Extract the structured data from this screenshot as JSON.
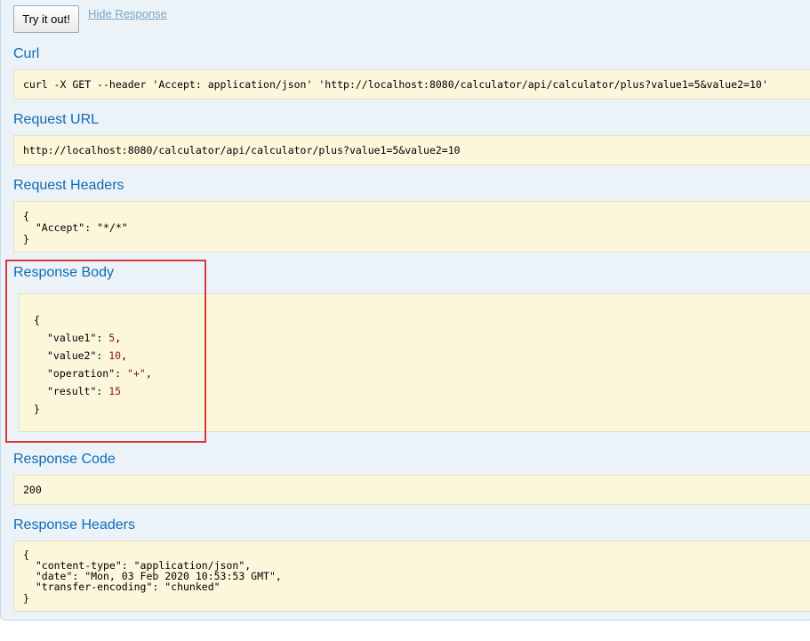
{
  "actions": {
    "try_button": "Try it out!",
    "hide_link": "Hide Response"
  },
  "curl": {
    "title": "Curl",
    "value": "curl -X GET --header 'Accept: application/json' 'http://localhost:8080/calculator/api/calculator/plus?value1=5&value2=10'"
  },
  "request_url": {
    "title": "Request URL",
    "value": "http://localhost:8080/calculator/api/calculator/plus?value1=5&value2=10"
  },
  "request_headers": {
    "title": "Request Headers",
    "lines": [
      "{",
      "  \"Accept\": \"*/*\"",
      "}"
    ]
  },
  "response_body": {
    "title": "Response Body",
    "open": "{",
    "close": "}",
    "fields": [
      {
        "key": "\"value1\"",
        "sep": ": ",
        "value": "5",
        "tail": ","
      },
      {
        "key": "\"value2\"",
        "sep": ": ",
        "value": "10",
        "tail": ","
      },
      {
        "key": "\"operation\"",
        "sep": ": ",
        "value": "\"+\"",
        "tail": ","
      },
      {
        "key": "\"result\"",
        "sep": ": ",
        "value": "15",
        "tail": ""
      }
    ]
  },
  "response_code": {
    "title": "Response Code",
    "value": "200"
  },
  "response_headers": {
    "title": "Response Headers",
    "lines": [
      "{",
      "  \"content-type\": \"application/json\",",
      "  \"date\": \"Mon, 03 Feb 2020 10:53:53 GMT\",",
      "  \"transfer-encoding\": \"chunked\"",
      "}"
    ]
  },
  "colors": {
    "accent": "#0f6ab4",
    "highlight": "#d93838",
    "code_bg": "#fcf6db"
  }
}
